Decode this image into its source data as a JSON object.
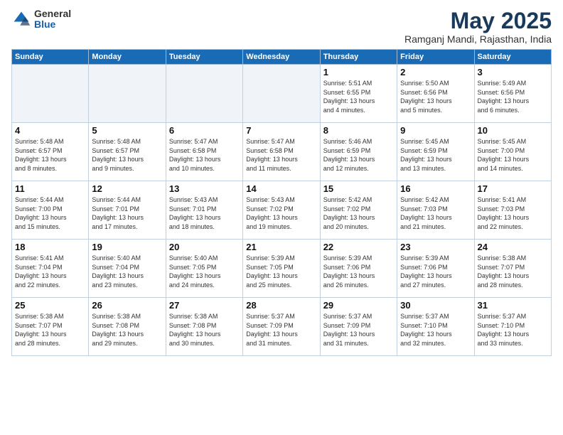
{
  "header": {
    "logo_general": "General",
    "logo_blue": "Blue",
    "month_title": "May 2025",
    "location": "Ramganj Mandi, Rajasthan, India"
  },
  "days_of_week": [
    "Sunday",
    "Monday",
    "Tuesday",
    "Wednesday",
    "Thursday",
    "Friday",
    "Saturday"
  ],
  "weeks": [
    [
      {
        "day": "",
        "info": ""
      },
      {
        "day": "",
        "info": ""
      },
      {
        "day": "",
        "info": ""
      },
      {
        "day": "",
        "info": ""
      },
      {
        "day": "1",
        "info": "Sunrise: 5:51 AM\nSunset: 6:55 PM\nDaylight: 13 hours\nand 4 minutes."
      },
      {
        "day": "2",
        "info": "Sunrise: 5:50 AM\nSunset: 6:56 PM\nDaylight: 13 hours\nand 5 minutes."
      },
      {
        "day": "3",
        "info": "Sunrise: 5:49 AM\nSunset: 6:56 PM\nDaylight: 13 hours\nand 6 minutes."
      }
    ],
    [
      {
        "day": "4",
        "info": "Sunrise: 5:48 AM\nSunset: 6:57 PM\nDaylight: 13 hours\nand 8 minutes."
      },
      {
        "day": "5",
        "info": "Sunrise: 5:48 AM\nSunset: 6:57 PM\nDaylight: 13 hours\nand 9 minutes."
      },
      {
        "day": "6",
        "info": "Sunrise: 5:47 AM\nSunset: 6:58 PM\nDaylight: 13 hours\nand 10 minutes."
      },
      {
        "day": "7",
        "info": "Sunrise: 5:47 AM\nSunset: 6:58 PM\nDaylight: 13 hours\nand 11 minutes."
      },
      {
        "day": "8",
        "info": "Sunrise: 5:46 AM\nSunset: 6:59 PM\nDaylight: 13 hours\nand 12 minutes."
      },
      {
        "day": "9",
        "info": "Sunrise: 5:45 AM\nSunset: 6:59 PM\nDaylight: 13 hours\nand 13 minutes."
      },
      {
        "day": "10",
        "info": "Sunrise: 5:45 AM\nSunset: 7:00 PM\nDaylight: 13 hours\nand 14 minutes."
      }
    ],
    [
      {
        "day": "11",
        "info": "Sunrise: 5:44 AM\nSunset: 7:00 PM\nDaylight: 13 hours\nand 15 minutes."
      },
      {
        "day": "12",
        "info": "Sunrise: 5:44 AM\nSunset: 7:01 PM\nDaylight: 13 hours\nand 17 minutes."
      },
      {
        "day": "13",
        "info": "Sunrise: 5:43 AM\nSunset: 7:01 PM\nDaylight: 13 hours\nand 18 minutes."
      },
      {
        "day": "14",
        "info": "Sunrise: 5:43 AM\nSunset: 7:02 PM\nDaylight: 13 hours\nand 19 minutes."
      },
      {
        "day": "15",
        "info": "Sunrise: 5:42 AM\nSunset: 7:02 PM\nDaylight: 13 hours\nand 20 minutes."
      },
      {
        "day": "16",
        "info": "Sunrise: 5:42 AM\nSunset: 7:03 PM\nDaylight: 13 hours\nand 21 minutes."
      },
      {
        "day": "17",
        "info": "Sunrise: 5:41 AM\nSunset: 7:03 PM\nDaylight: 13 hours\nand 22 minutes."
      }
    ],
    [
      {
        "day": "18",
        "info": "Sunrise: 5:41 AM\nSunset: 7:04 PM\nDaylight: 13 hours\nand 22 minutes."
      },
      {
        "day": "19",
        "info": "Sunrise: 5:40 AM\nSunset: 7:04 PM\nDaylight: 13 hours\nand 23 minutes."
      },
      {
        "day": "20",
        "info": "Sunrise: 5:40 AM\nSunset: 7:05 PM\nDaylight: 13 hours\nand 24 minutes."
      },
      {
        "day": "21",
        "info": "Sunrise: 5:39 AM\nSunset: 7:05 PM\nDaylight: 13 hours\nand 25 minutes."
      },
      {
        "day": "22",
        "info": "Sunrise: 5:39 AM\nSunset: 7:06 PM\nDaylight: 13 hours\nand 26 minutes."
      },
      {
        "day": "23",
        "info": "Sunrise: 5:39 AM\nSunset: 7:06 PM\nDaylight: 13 hours\nand 27 minutes."
      },
      {
        "day": "24",
        "info": "Sunrise: 5:38 AM\nSunset: 7:07 PM\nDaylight: 13 hours\nand 28 minutes."
      }
    ],
    [
      {
        "day": "25",
        "info": "Sunrise: 5:38 AM\nSunset: 7:07 PM\nDaylight: 13 hours\nand 28 minutes."
      },
      {
        "day": "26",
        "info": "Sunrise: 5:38 AM\nSunset: 7:08 PM\nDaylight: 13 hours\nand 29 minutes."
      },
      {
        "day": "27",
        "info": "Sunrise: 5:38 AM\nSunset: 7:08 PM\nDaylight: 13 hours\nand 30 minutes."
      },
      {
        "day": "28",
        "info": "Sunrise: 5:37 AM\nSunset: 7:09 PM\nDaylight: 13 hours\nand 31 minutes."
      },
      {
        "day": "29",
        "info": "Sunrise: 5:37 AM\nSunset: 7:09 PM\nDaylight: 13 hours\nand 31 minutes."
      },
      {
        "day": "30",
        "info": "Sunrise: 5:37 AM\nSunset: 7:10 PM\nDaylight: 13 hours\nand 32 minutes."
      },
      {
        "day": "31",
        "info": "Sunrise: 5:37 AM\nSunset: 7:10 PM\nDaylight: 13 hours\nand 33 minutes."
      }
    ]
  ]
}
